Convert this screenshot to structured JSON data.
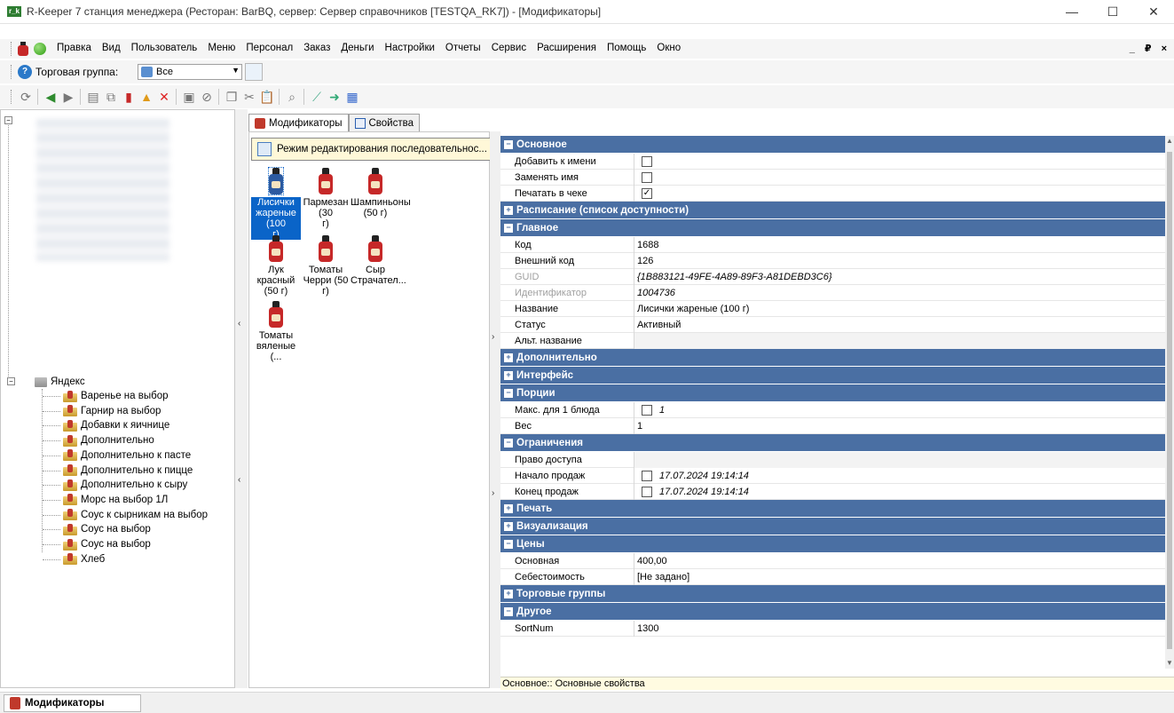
{
  "window": {
    "title": "R-Keeper 7 станция менеджера (Ресторан: BarBQ, сервер: Сервер справочников [TESTQA_RK7]) - [Модификаторы]",
    "minimize": "—",
    "maximize": "☐",
    "close": "✕"
  },
  "menu": {
    "items": [
      "Правка",
      "Вид",
      "Пользователь",
      "Меню",
      "Персонал",
      "Заказ",
      "Деньги",
      "Настройки",
      "Отчеты",
      "Сервис",
      "Расширения",
      "Помощь",
      "Окно"
    ],
    "mdi_controls": "_ ₽ ×"
  },
  "group_bar": {
    "label": "Торговая группа:",
    "selected": "Все"
  },
  "tree": {
    "root_label": "Яндекс",
    "items": [
      "Варенье на выбор",
      "Гарнир на выбор",
      "Добавки к яичнице",
      "Дополнительно",
      "Дополнительно к пасте",
      "Дополнительно к пицце",
      "Дополнительно к сыру",
      "Морс на выбор 1Л",
      "Соус к сырникам на выбор",
      "Соус на выбор",
      "Соус на выбор",
      "Хлеб"
    ]
  },
  "tabs": {
    "modifiers": "Модификаторы",
    "properties": "Свойства"
  },
  "modifiers_pane": {
    "sequence_button": "Режим редактирования последовательнос...",
    "items": [
      {
        "line1": "Лисички",
        "line2": "жареные (100",
        "line3": "г)"
      },
      {
        "line1": "Пармезан (30",
        "line2": "г)",
        "line3": ""
      },
      {
        "line1": "Шампиньоны",
        "line2": "(50 г)",
        "line3": ""
      },
      {
        "line1": "Лук красный",
        "line2": "(50 г)",
        "line3": ""
      },
      {
        "line1": "Томаты",
        "line2": "Черри (50 г)",
        "line3": ""
      },
      {
        "line1": "Сыр",
        "line2": "Страчател...",
        "line3": ""
      },
      {
        "line1": "Томаты",
        "line2": "вяленые (...",
        "line3": ""
      }
    ]
  },
  "properties": {
    "cat_basic": "Основное",
    "add_to_name": "Добавить к имени",
    "replace_name": "Заменять имя",
    "print_receipt": "Печатать в чеке",
    "cat_schedule": "Расписание (список доступности)",
    "cat_main": "Главное",
    "code_label": "Код",
    "code_value": "1688",
    "ext_code_label": "Внешний код",
    "ext_code_value": "126",
    "guid_label": "GUID",
    "guid_value": "{1B883121-49FE-4A89-89F3-A81DEBD3C6}",
    "ident_label": "Идентификатор",
    "ident_value": "1004736",
    "name_label": "Название",
    "name_value": "Лисички жареные (100 г)",
    "status_label": "Статус",
    "status_value": "Активный",
    "alt_name_label": "Альт. название",
    "cat_additional": "Дополнительно",
    "cat_interface": "Интерфейс",
    "cat_portions": "Порции",
    "max_per_dish_label": "Макс. для 1 блюда",
    "max_per_dish_value": "1",
    "weight_label": "Вес",
    "weight_value": "1",
    "cat_limits": "Ограничения",
    "access_label": "Право доступа",
    "sale_start_label": "Начало продаж",
    "sale_start_value": "17.07.2024 19:14:14",
    "sale_end_label": "Конец продаж",
    "sale_end_value": "17.07.2024 19:14:14",
    "cat_print": "Печать",
    "cat_visual": "Визуализация",
    "cat_prices": "Цены",
    "price_main_label": "Основная",
    "price_main_value": "400,00",
    "cost_label": "Себестоимость",
    "cost_value": "[Не задано]",
    "cat_trade_groups": "Торговые группы",
    "cat_other": "Другое",
    "sortnum_label": "SortNum",
    "sortnum_value": "1300"
  },
  "status_line": "Основное:: Основные свойства",
  "taskbar": {
    "button": "Модификаторы"
  }
}
